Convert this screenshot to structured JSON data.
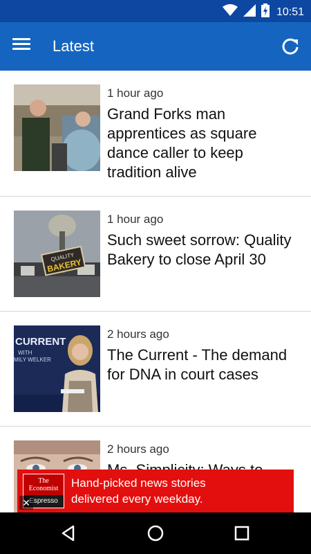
{
  "status_bar": {
    "time": "10:51",
    "icons": [
      "wifi-icon",
      "signal-icon",
      "battery-charging-icon"
    ]
  },
  "app_bar": {
    "title": "Latest",
    "menu_icon": "menu-icon",
    "refresh_icon": "refresh-icon"
  },
  "feed": {
    "items": [
      {
        "time": "1 hour ago",
        "headline": "Grand Forks man apprentices as square dance caller to keep tradition alive"
      },
      {
        "time": "1 hour ago",
        "headline": "Such sweet sorrow: Quality Bakery to close April 30"
      },
      {
        "time": "2 hours ago",
        "headline": "The Current - The demand for DNA in court cases"
      },
      {
        "time": "2 hours ago",
        "headline": "Ms. Simplicity: Ways to"
      }
    ],
    "thumb_texts": {
      "bakery_sign_top": "QUALITY",
      "bakery_sign_bottom": "BAKERY",
      "current_title": "CURRENT",
      "current_with": "WITH",
      "current_host": "MILY WELKER"
    }
  },
  "ad": {
    "logo_top": "The Economist",
    "logo_bottom": "Espresso",
    "text_line1": "Hand-picked news stories",
    "text_line2": "delivered every weekday.",
    "close_label": "✕",
    "background_color": "#e30f0f"
  },
  "nav_bar": {
    "icons": [
      "back-icon",
      "home-icon",
      "recents-icon"
    ]
  },
  "colors": {
    "status_bar": "#0d47a1",
    "app_bar": "#1565c0"
  }
}
